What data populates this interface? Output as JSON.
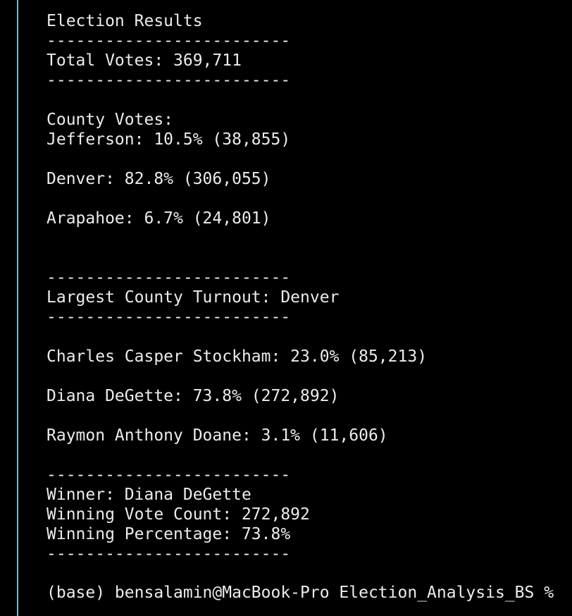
{
  "terminal": {
    "background_color": "#000000",
    "text_color": "#ececec",
    "border_color": "#7fb6d8",
    "lines": [
      "Election Results",
      "-------------------------",
      "Total Votes: 369,711",
      "-------------------------",
      "",
      "County Votes:",
      "Jefferson: 10.5% (38,855)",
      "",
      "Denver: 82.8% (306,055)",
      "",
      "Arapahoe: 6.7% (24,801)",
      "",
      "",
      "-------------------------",
      "Largest County Turnout: Denver",
      "-------------------------",
      "",
      "Charles Casper Stockham: 23.0% (85,213)",
      "",
      "Diana DeGette: 73.8% (272,892)",
      "",
      "Raymon Anthony Doane: 3.1% (11,606)",
      "",
      "-------------------------",
      "Winner: Diana DeGette",
      "Winning Vote Count: 272,892",
      "Winning Percentage: 73.8%",
      "-------------------------"
    ],
    "prompt": "(base) bensalamin@MacBook-Pro Election_Analysis_BS %"
  }
}
